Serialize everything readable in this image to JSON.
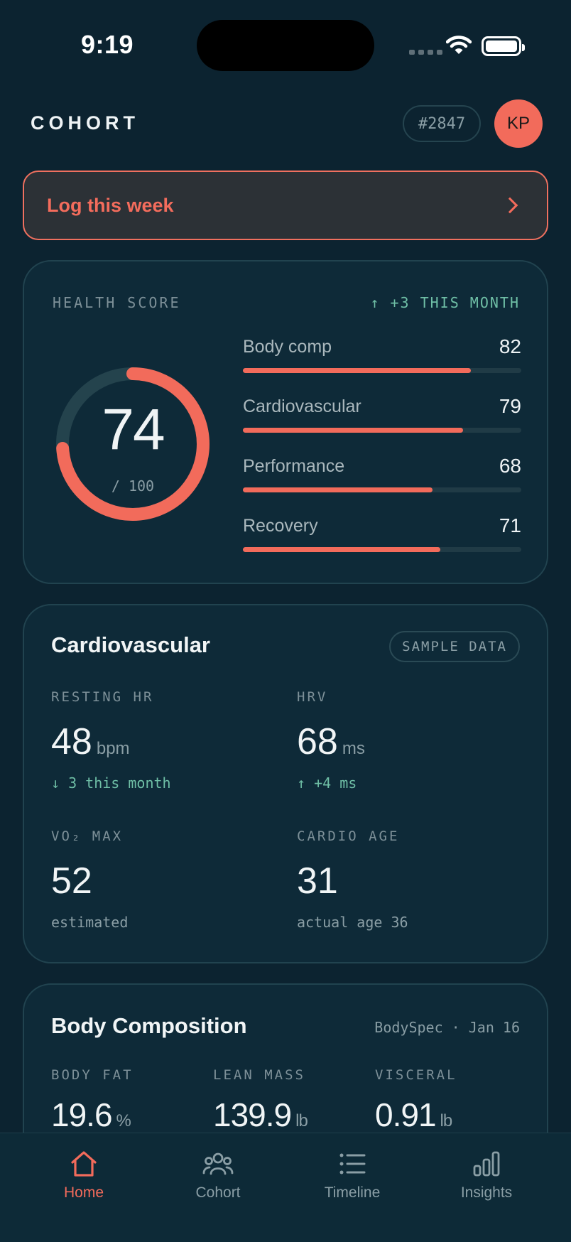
{
  "status_bar": {
    "time": "9:19"
  },
  "header": {
    "brand": "COHORT",
    "member_id": "#2847",
    "avatar_initials": "KP"
  },
  "log_banner": {
    "label": "Log this week"
  },
  "health_score": {
    "title": "HEALTH SCORE",
    "delta": "↑ +3 THIS MONTH",
    "score": 74,
    "score_display": "74",
    "out_of": "/ 100",
    "metrics": [
      {
        "name": "Body comp",
        "value": "82",
        "fraction": 0.82
      },
      {
        "name": "Cardiovascular",
        "value": "79",
        "fraction": 0.79
      },
      {
        "name": "Performance",
        "value": "68",
        "fraction": 0.68
      },
      {
        "name": "Recovery",
        "value": "71",
        "fraction": 0.71
      }
    ]
  },
  "cardiovascular": {
    "title": "Cardiovascular",
    "badge": "SAMPLE DATA",
    "stats": [
      {
        "label": "RESTING HR",
        "value": "48",
        "unit": "bpm",
        "sub": "↓ 3 this month"
      },
      {
        "label": "HRV",
        "value": "68",
        "unit": "ms",
        "sub": "↑ +4 ms"
      },
      {
        "label": "VO₂ MAX",
        "value": "52",
        "unit": "",
        "sub": "estimated"
      },
      {
        "label": "CARDIO AGE",
        "value": "31",
        "unit": "",
        "sub": "actual age 36"
      }
    ]
  },
  "body_composition": {
    "title": "Body Composition",
    "source": "BodySpec · Jan 16",
    "stats": [
      {
        "label": "BODY FAT",
        "value": "19.6",
        "unit": "%"
      },
      {
        "label": "LEAN MASS",
        "value": "139.9",
        "unit": "lb"
      },
      {
        "label": "VISCERAL",
        "value": "0.91",
        "unit": "lb"
      }
    ]
  },
  "tab_bar": {
    "tabs": [
      {
        "label": "Home",
        "icon": "home-icon",
        "active": true
      },
      {
        "label": "Cohort",
        "icon": "people-icon",
        "active": false
      },
      {
        "label": "Timeline",
        "icon": "list-icon",
        "active": false
      },
      {
        "label": "Insights",
        "icon": "bar-chart-icon",
        "active": false
      }
    ]
  },
  "colors": {
    "background": "#0c2330",
    "card": "#0e2a38",
    "accent": "#f26b5b",
    "positive": "#6fbfa6",
    "muted": "#8a9ea5"
  }
}
